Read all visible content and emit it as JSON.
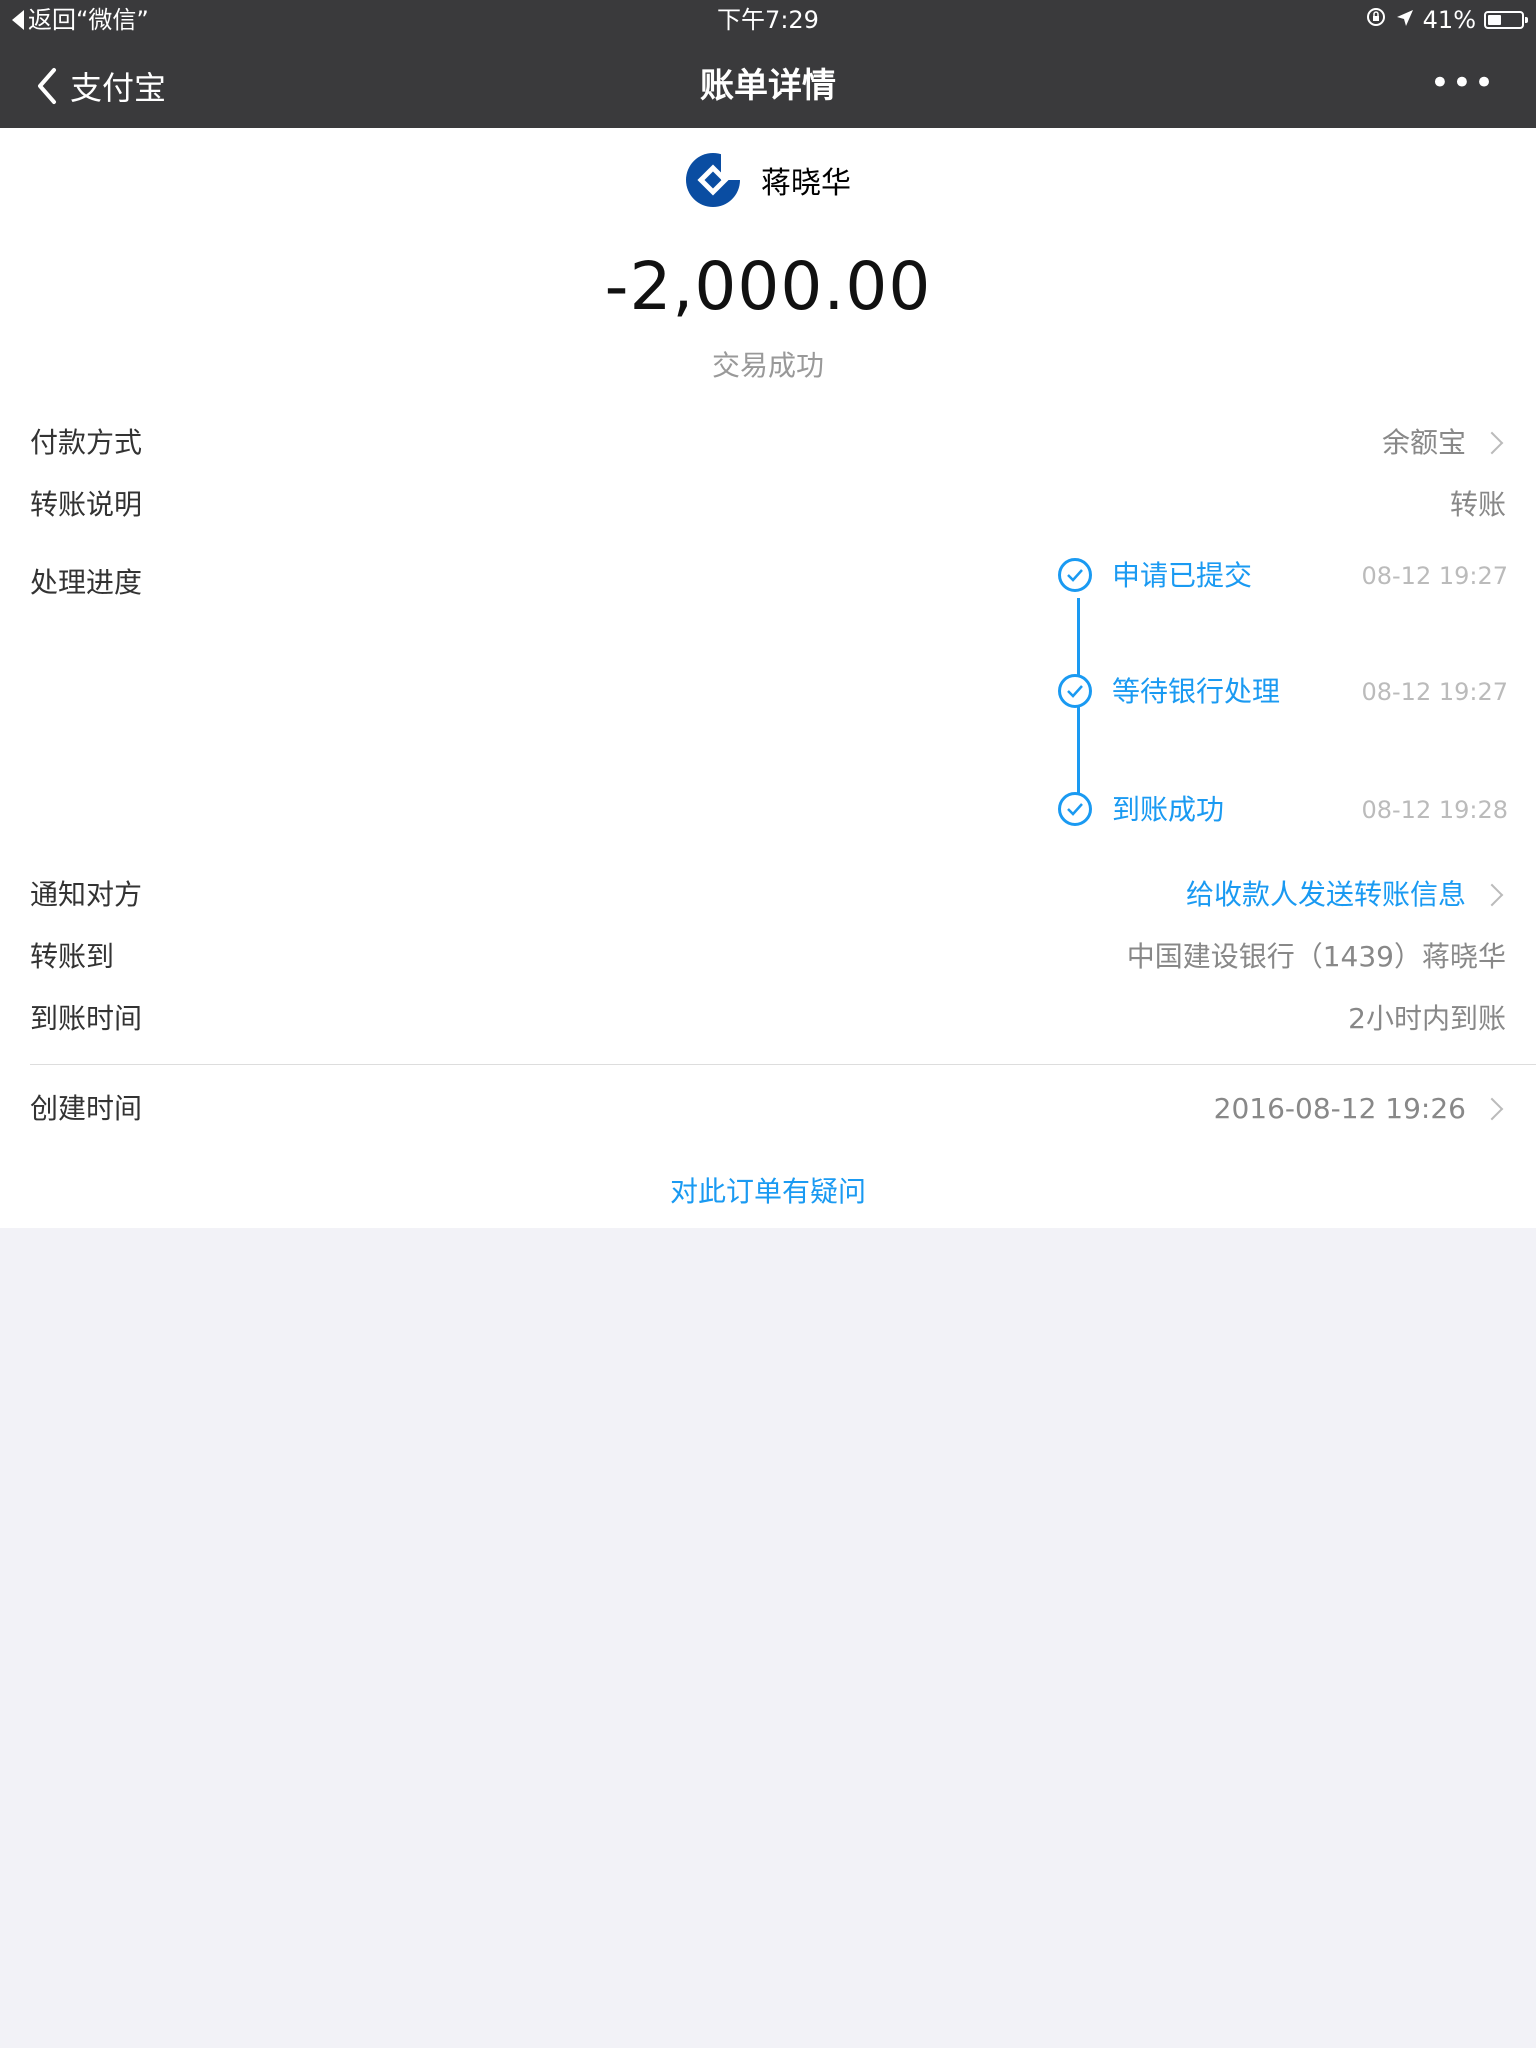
{
  "status_bar": {
    "back_app": "返回“微信”",
    "time": "下午7:29",
    "battery": "41%",
    "battery_level": 0.41
  },
  "nav": {
    "back_label": "支付宝",
    "title": "账单详情",
    "more": "•••"
  },
  "payee": {
    "name": "蒋晓华",
    "logo_icon": "ccb-bank-logo-icon",
    "logo_color": "#0a4da2"
  },
  "amount": "-2,000.00",
  "trade_status": "交易成功",
  "details": {
    "payment_method": {
      "label": "付款方式",
      "value": "余额宝"
    },
    "transfer_note": {
      "label": "转账说明",
      "value": "转账"
    },
    "progress": {
      "label": "处理进度",
      "steps": [
        {
          "text": "申请已提交",
          "time": "08-12 19:27"
        },
        {
          "text": "等待银行处理",
          "time": "08-12 19:27"
        },
        {
          "text": "到账成功",
          "time": "08-12 19:28"
        }
      ]
    },
    "notify": {
      "label": "通知对方",
      "value": "给收款人发送转账信息"
    },
    "transfer_to": {
      "label": "转账到",
      "value": "中国建设银行（1439）蒋晓华"
    },
    "arrival_time": {
      "label": "到账时间",
      "value": "2小时内到账"
    },
    "created": {
      "label": "创建时间",
      "value": "2016-08-12 19:26"
    }
  },
  "question_link": "对此订单有疑问",
  "colors": {
    "accent": "#1a9af2",
    "topbar": "#3a3a3c",
    "page_bg": "#f2f2f7"
  }
}
